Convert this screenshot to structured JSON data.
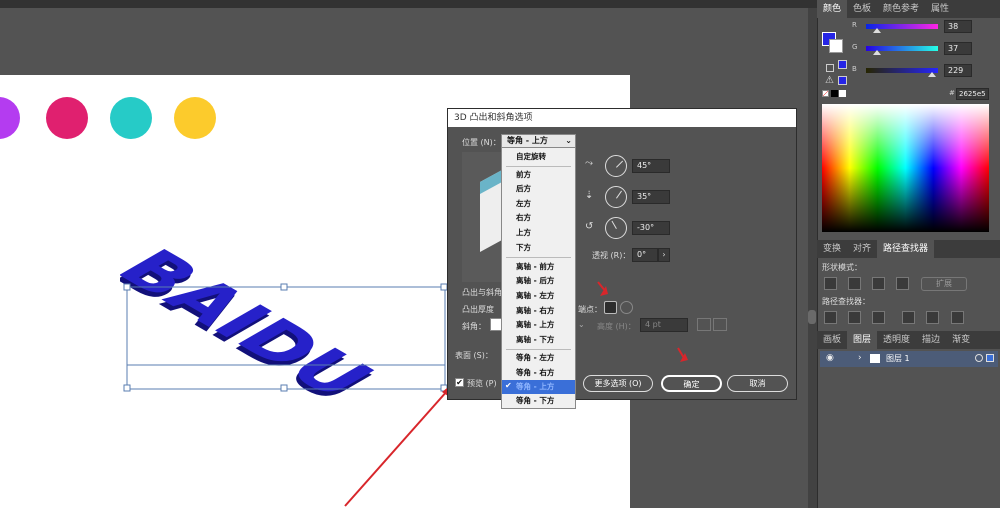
{
  "dialog": {
    "title": "3D 凸出和斜角选项",
    "position_label": "位置 (N)：",
    "position_value": "等角 - 上方",
    "angle_x": "45°",
    "angle_y": "35°",
    "angle_z": "-30°",
    "perspective_label": "透视 (R)：",
    "perspective_value": "0°",
    "extrude_section_label": "凸出与斜角",
    "extrude_depth_label": "凸出厚度",
    "cap_label": "端点：",
    "bevel_label": "斜角：",
    "height_label": "高度 (H)：",
    "height_value": "4 pt",
    "surface_label": "表面 (S)：",
    "preview_label": "预览 (P)",
    "more_options_button": "更多选项 (O)",
    "ok_button": "确定",
    "cancel_button": "取消"
  },
  "position_menu": {
    "items": [
      "自定旋转",
      "前方",
      "后方",
      "左方",
      "右方",
      "上方",
      "下方",
      "离轴 - 前方",
      "离轴 - 后方",
      "离轴 - 左方",
      "离轴 - 右方",
      "离轴 - 上方",
      "离轴 - 下方",
      "等角 - 左方",
      "等角 - 右方",
      "等角 - 上方",
      "等角 - 下方"
    ],
    "selected": "等角 - 上方",
    "checkmark": "✔"
  },
  "color_panel": {
    "tabs": [
      "颜色",
      "色板",
      "颜色参考",
      "属性"
    ],
    "r_label": "R",
    "g_label": "G",
    "b_label": "B",
    "r_value": "38",
    "g_value": "37",
    "b_value": "229",
    "hex_prefix": "#",
    "hex_value": "2625e5",
    "fill_color": "#2625e5"
  },
  "pathfinder_panel": {
    "tabs": [
      "变换",
      "对齐",
      "路径查找器"
    ],
    "shape_modes_label": "形状模式：",
    "expand_button": "扩展",
    "pathfinders_label": "路径查找器："
  },
  "layers_panel": {
    "tabs": [
      "画板",
      "图层",
      "透明度",
      "描边",
      "渐变"
    ],
    "layer_name": "图层 1"
  },
  "artboard": {
    "circle_colors": [
      "#b43cf0",
      "#e0206f",
      "#26cbc7",
      "#fccb2c"
    ],
    "text_3d": "BAIDU",
    "text_color": "#2621c9"
  }
}
